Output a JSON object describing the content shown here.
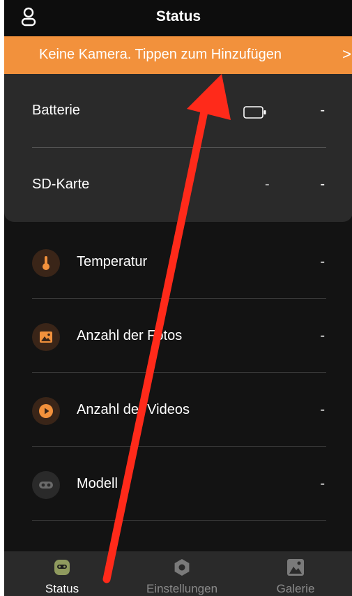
{
  "header": {
    "title": "Status",
    "profile_icon": "person-icon"
  },
  "banner": {
    "text": "Keine Kamera. Tippen zum Hinzufügen",
    "chevron": ">",
    "color": "#f2913c"
  },
  "card": {
    "rows": [
      {
        "label": "Batterie",
        "value": "-",
        "icon": "battery-icon"
      },
      {
        "label": "SD-Karte",
        "value": "-",
        "secondary_value": "-"
      }
    ]
  },
  "list": {
    "items": [
      {
        "label": "Temperatur",
        "value": "-",
        "icon": "thermometer-icon"
      },
      {
        "label": "Anzahl der Fotos",
        "value": "-",
        "icon": "photo-icon"
      },
      {
        "label": "Anzahl der Videos",
        "value": "-",
        "icon": "video-play-icon"
      },
      {
        "label": "Modell",
        "value": "-",
        "icon": "camera-model-icon"
      }
    ]
  },
  "tabbar": {
    "tabs": [
      {
        "label": "Status",
        "icon": "status-icon",
        "active": true
      },
      {
        "label": "Einstellungen",
        "icon": "settings-icon",
        "active": false
      },
      {
        "label": "Galerie",
        "icon": "gallery-icon",
        "active": false
      }
    ]
  },
  "annotation": {
    "type": "red-arrow",
    "color": "#ff2a1a"
  },
  "colors": {
    "accent": "#f2913c",
    "background": "#131313",
    "card": "#2a2a2a"
  }
}
